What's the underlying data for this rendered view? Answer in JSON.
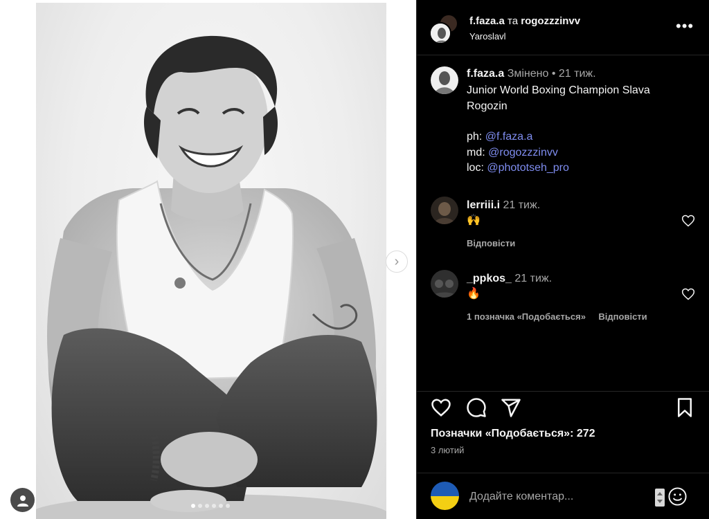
{
  "header": {
    "author": "f.faza.a",
    "conjunction": "та",
    "coauthor": "rogozzzinvv",
    "location": "Yaroslavl",
    "more_icon": "more-horizontal-icon"
  },
  "caption": {
    "username": "f.faza.a",
    "edited": "Змінено",
    "separator": "•",
    "time": "21 тиж.",
    "text": "Junior World Boxing Champion Slava Rogozin",
    "credits": [
      {
        "prefix": "ph:",
        "mention": "@f.faza.a"
      },
      {
        "prefix": "md:",
        "mention": "@rogozzzinvv"
      },
      {
        "prefix": "loc:",
        "mention": "@phototseh_pro"
      }
    ]
  },
  "comments": [
    {
      "username": "lerriii.i",
      "time": "21 тиж.",
      "text": "🙌",
      "reply_label": "Відповісти",
      "like_icon": "heart-outline-icon"
    },
    {
      "username": "_ppkos_",
      "time": "21 тиж.",
      "text": "🔥",
      "likes_label": "1 позначка «Подобається»",
      "reply_label": "Відповісти",
      "like_icon": "heart-outline-icon"
    }
  ],
  "actions": {
    "like_icon": "heart-outline-icon",
    "comment_icon": "comment-bubble-icon",
    "share_icon": "paper-plane-icon",
    "save_icon": "bookmark-outline-icon"
  },
  "likes_text": "Позначки «Подобається»: 272",
  "date": "3 лютий",
  "comment_box": {
    "placeholder": "Додайте коментар...",
    "emoji_icon": "smiley-icon"
  },
  "carousel": {
    "next_icon": "chevron-right-icon",
    "slides": 6,
    "active_slide": 1
  },
  "colors": {
    "panel_bg": "#000000",
    "link": "#7f8df0",
    "muted": "#a8a8a8",
    "flag_blue": "#1e5bb5",
    "flag_yellow": "#f4cf13"
  }
}
